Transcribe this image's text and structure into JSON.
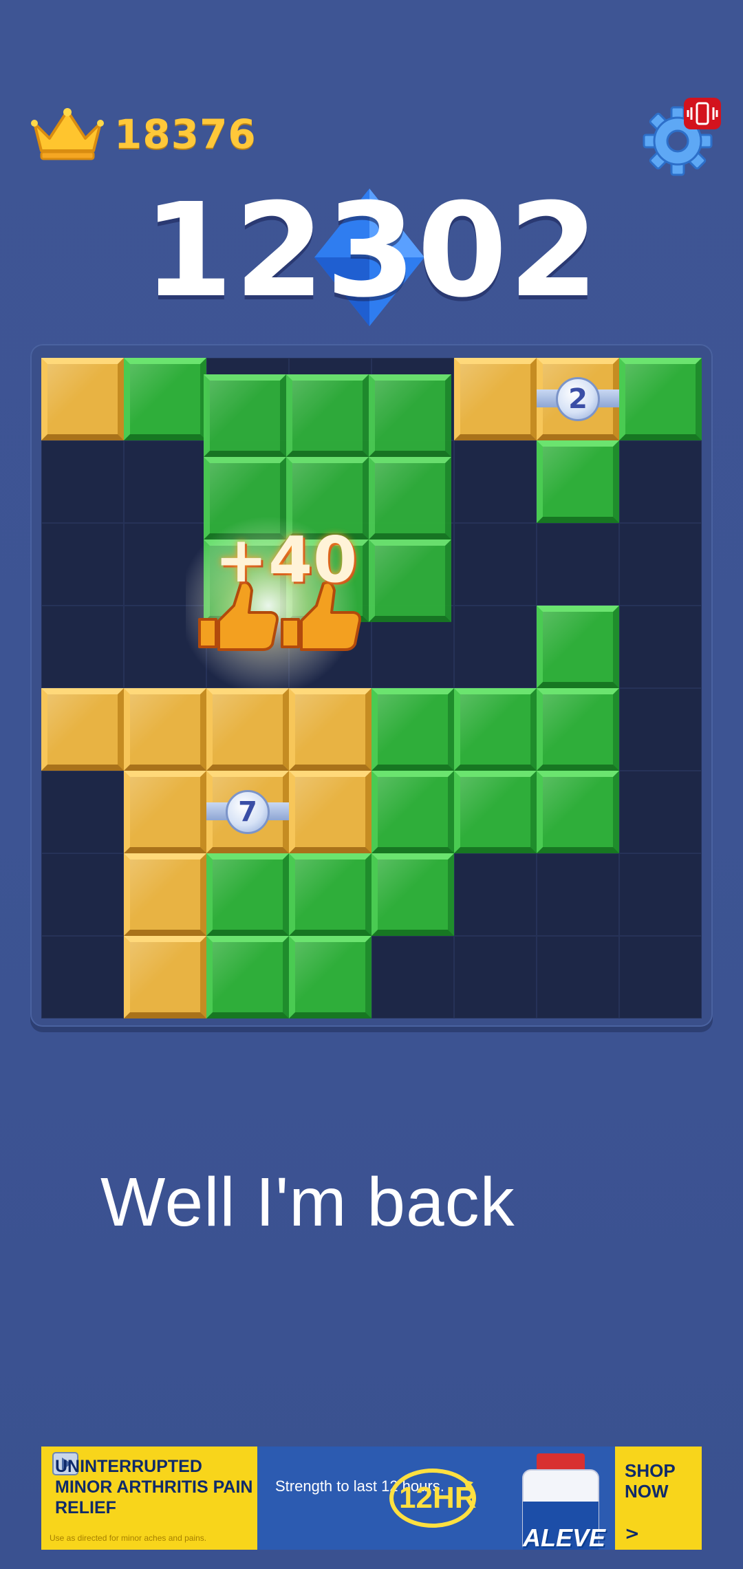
{
  "hud": {
    "best_score": "18376",
    "current_score": "12302",
    "settings_icon": "gear-icon",
    "vibration_icon": "vibration-icon",
    "crown_icon": "crown-icon",
    "colors": {
      "best": "#ffc83a",
      "badge": "#d3131d",
      "accent": "#2f7df0"
    }
  },
  "board": {
    "rows": 8,
    "cols": 8,
    "grid": [
      "YG...YYG",
      "......G.",
      "........",
      "......G.",
      "YYYYGGG.",
      ".YYYGGG.",
      ".YGGG...",
      ".YGG...."
    ],
    "ghost_piece": {
      "color": "green",
      "cells": [
        [
          0,
          2
        ],
        [
          0,
          3
        ],
        [
          0,
          4
        ],
        [
          1,
          2
        ],
        [
          1,
          3
        ],
        [
          1,
          4
        ],
        [
          2,
          2
        ],
        [
          2,
          3
        ],
        [
          2,
          4
        ]
      ]
    },
    "badges": [
      {
        "row": 0,
        "col": 6,
        "value": "2"
      },
      {
        "row": 5,
        "col": 2,
        "value": "7"
      }
    ],
    "colors": {
      "Y": "#e8b343",
      "G": "#2fae3a",
      "empty": "#1d2747"
    }
  },
  "combo": {
    "text": "+40",
    "icon": "thumbs-up-icon"
  },
  "caption": "Well I'm back",
  "ad": {
    "headline": "UNINTERRUPTED MINOR ARTHRITIS PAIN RELIEF",
    "fine_print": "Use as directed for minor aches and pains.",
    "tagline": "Strength to last 12 hours.",
    "badge": "12HR",
    "brand": "ALEVE",
    "cta": "SHOP NOW",
    "cta_arrow": ">",
    "play_icon": "play-icon"
  }
}
